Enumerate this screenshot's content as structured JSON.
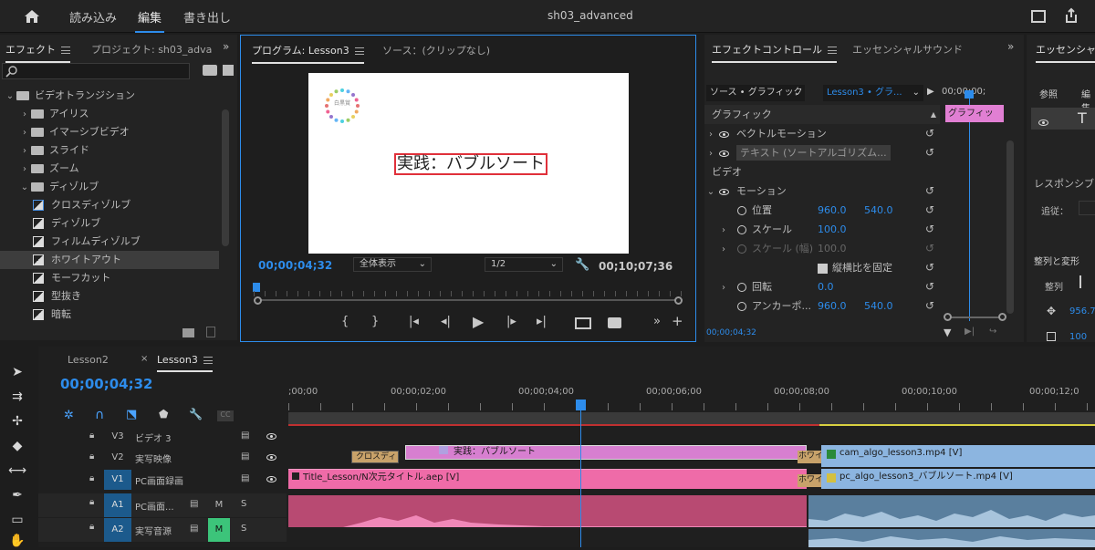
{
  "topbar": {
    "title": "sh03_advanced",
    "tabs": [
      "読み込み",
      "編集",
      "書き出し"
    ]
  },
  "effects_panel": {
    "tabs": [
      "エフェクト",
      "プロジェクト: sh03_adva"
    ],
    "tree": [
      {
        "label": "ビデオトランジション",
        "kind": "folder",
        "level": 0,
        "open": true
      },
      {
        "label": "アイリス",
        "kind": "folder",
        "level": 1
      },
      {
        "label": "イマーシブビデオ",
        "kind": "folder",
        "level": 1
      },
      {
        "label": "スライド",
        "kind": "folder",
        "level": 1
      },
      {
        "label": "ズーム",
        "kind": "folder",
        "level": 1
      },
      {
        "label": "ディゾルブ",
        "kind": "folder",
        "level": 1,
        "open": true
      },
      {
        "label": "クロスディゾルブ",
        "kind": "effect",
        "level": 2
      },
      {
        "label": "ディゾルブ",
        "kind": "effect",
        "level": 2
      },
      {
        "label": "フィルムディゾルブ",
        "kind": "effect",
        "level": 2
      },
      {
        "label": "ホワイトアウト",
        "kind": "effect",
        "level": 2,
        "selected": true
      },
      {
        "label": "モーフカット",
        "kind": "effect",
        "level": 2
      },
      {
        "label": "型抜き",
        "kind": "effect",
        "level": 2
      },
      {
        "label": "暗転",
        "kind": "effect",
        "level": 2
      }
    ]
  },
  "program_monitor": {
    "tabs": [
      "プログラム: Lesson3",
      "ソース：(クリップなし)"
    ],
    "video_title": "実践：バブルソート",
    "logo_text": "白黒賞",
    "timecode": "00;00;04;32",
    "fit": "全体表示",
    "resolution": "1/2",
    "duration": "00;10;07;36"
  },
  "effect_controls": {
    "tabs": [
      "エフェクトコントロール",
      "エッセンシャルサウンド"
    ],
    "source_label": "ソース • グラフィック",
    "clip_label": "Lesson3 • グラ...",
    "ruler_tc": "00;00;00;",
    "clip_name": "グラフィッ",
    "timecode": "00;00;04;32",
    "rows": {
      "graphic": "グラフィック",
      "vector_motion": "ベクトルモーション",
      "text_layer": "テキスト (ソートアルゴリズム...",
      "video": "ビデオ",
      "motion": "モーション",
      "position": "位置",
      "pos_x": "960.0",
      "pos_y": "540.0",
      "scale": "スケール",
      "scale_v": "100.0",
      "scale_w": "スケール (幅)",
      "scale_w_v": "100.0",
      "uniform": "縦横比を固定",
      "rotation": "回転",
      "rot_v": "0.0",
      "anchor": "アンカーポ...",
      "anc_x": "960.0",
      "anc_y": "540.0"
    }
  },
  "essential_panel": {
    "title": "エッセンシャ",
    "tabs": [
      "参照",
      "編集"
    ],
    "responsive": "レスポンシブ",
    "follow": "追従：",
    "align": "整列と変形",
    "arrange": "整列",
    "pos": "956.7",
    "scale": "100"
  },
  "timeline": {
    "tabs": [
      "Lesson2",
      "Lesson3"
    ],
    "timecode": "00;00;04;32",
    "ruler": [
      ";00;00",
      "00;00;02;00",
      "00;00;04;00",
      "00;00;06;00",
      "00;00;08;00",
      "00;00;10;00",
      "00;00;12;0"
    ],
    "tracks": [
      {
        "id": "V3",
        "name": "ビデオ 3"
      },
      {
        "id": "V2",
        "name": "実写映像"
      },
      {
        "id": "V1",
        "name": "PC画面録画"
      },
      {
        "id": "A1",
        "name": "PC画面..."
      },
      {
        "id": "A2",
        "name": "実写音源"
      }
    ],
    "clips": {
      "v3_title": "実践：バブルソート",
      "v3_trans": "クロスディ",
      "v2_left": "Title_Lesson/N次元タイトル.aep [V]",
      "v2_trans": "ホワイ",
      "v2_right": "cam_algo_lesson3.mp4 [V]",
      "v1_trans": "ホワイ",
      "v1_right": "pc_algo_lesson3_バブルソート.mp4 [V]"
    },
    "track_buttons": {
      "mute": "M",
      "solo": "S"
    }
  }
}
